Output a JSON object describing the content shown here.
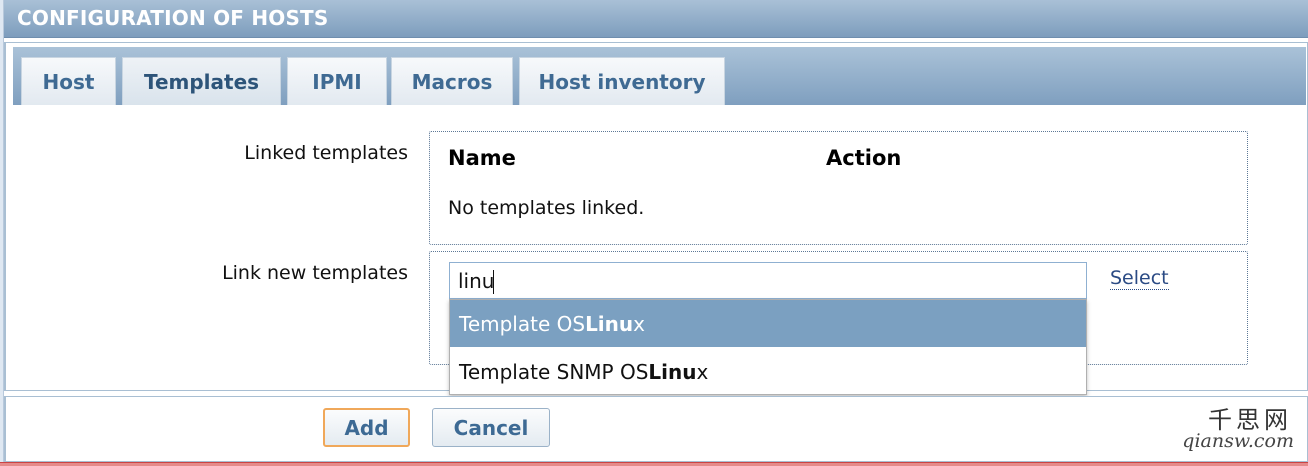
{
  "header": {
    "title": "CONFIGURATION OF HOSTS"
  },
  "tabs": [
    {
      "label": "Host",
      "active": false
    },
    {
      "label": "Templates",
      "active": true
    },
    {
      "label": "IPMI",
      "active": false
    },
    {
      "label": "Macros",
      "active": false
    },
    {
      "label": "Host inventory",
      "active": false
    }
  ],
  "linked": {
    "label": "Linked templates",
    "col_name": "Name",
    "col_action": "Action",
    "empty_text": "No templates linked."
  },
  "link_new": {
    "label": "Link new templates",
    "input_value": "linu",
    "select_link": "Select",
    "suggestions": [
      {
        "prefix": "Template OS ",
        "match": "Linu",
        "suffix": "x",
        "selected": true
      },
      {
        "prefix": "Template SNMP OS ",
        "match": "Linu",
        "suffix": "x",
        "selected": false
      }
    ]
  },
  "buttons": {
    "add": "Add",
    "cancel": "Cancel"
  },
  "watermark": {
    "top": "千思网",
    "bottom": "qiansw.com"
  },
  "colors": {
    "titlebar": "#8aa8c6",
    "tab_text": "#3f6a93",
    "suggest_highlight": "#7ba0c1",
    "add_border": "#f0a85a",
    "link": "#2a4a84"
  }
}
